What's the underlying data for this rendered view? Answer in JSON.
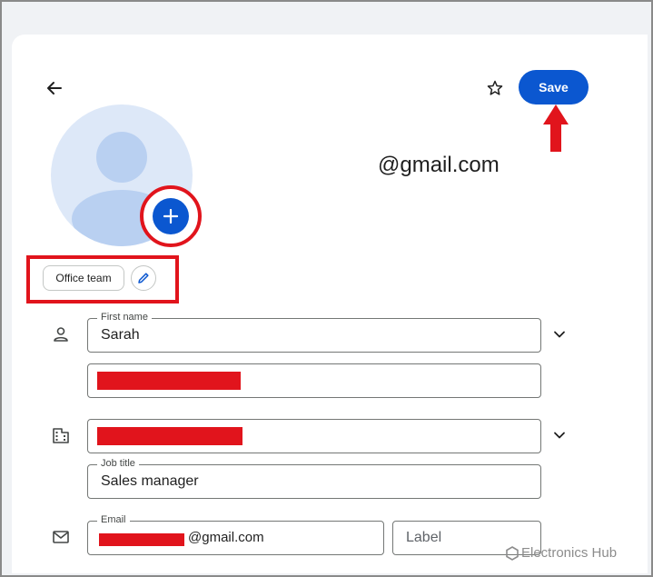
{
  "header": {
    "save_label": "Save",
    "email_display": "@gmail.com"
  },
  "labels": {
    "chip": "Office team"
  },
  "fields": {
    "first_name": {
      "label": "First name",
      "value": "Sarah"
    },
    "job_title": {
      "label": "Job title",
      "value": "Sales manager"
    },
    "email": {
      "label": "Email",
      "value_suffix": "@gmail.com"
    },
    "email_label": {
      "placeholder": "Label"
    }
  },
  "icons": {
    "back": "arrow-left-icon",
    "star": "star-icon",
    "add": "plus-icon",
    "edit": "pencil-icon",
    "person": "person-icon",
    "company": "building-icon",
    "email": "mail-icon",
    "expand": "chevron-down-icon"
  },
  "watermark": {
    "brand": "Electronics Hub"
  },
  "colors": {
    "accent": "#0b57d0",
    "highlight": "#e1141c",
    "avatar_bg": "#dde8f8"
  }
}
